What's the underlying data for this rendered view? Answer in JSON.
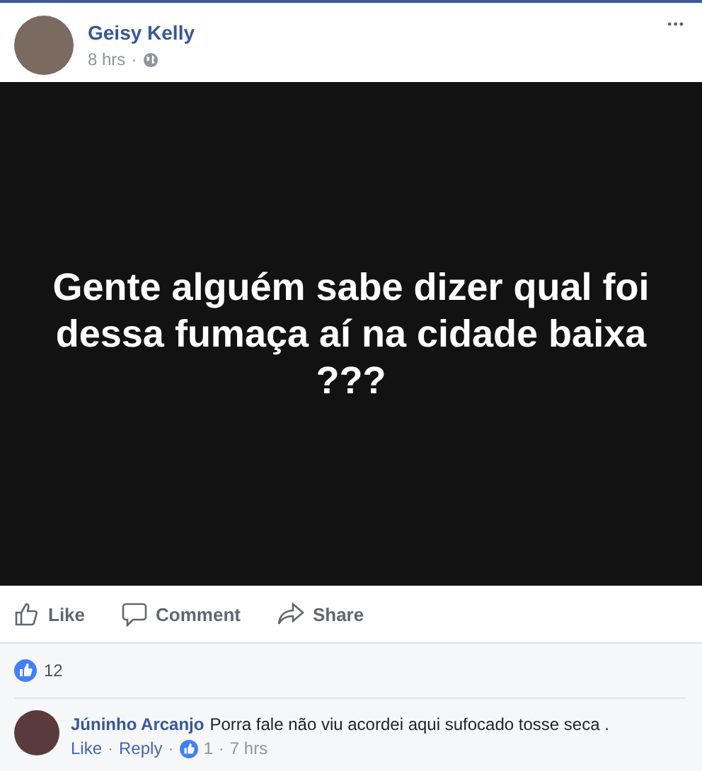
{
  "post": {
    "author": "Geisy Kelly",
    "time": "8 hrs",
    "separator": "·",
    "more": "•••",
    "image_text": "Gente alguém sabe dizer qual foi dessa fumaça aí na cidade baixa ???"
  },
  "actions": [
    {
      "kind": "like",
      "label": "Like"
    },
    {
      "kind": "comment",
      "label": "Comment"
    },
    {
      "kind": "share",
      "label": "Share"
    }
  ],
  "reactions": {
    "count": "12"
  },
  "comment": {
    "author": "Júninho Arcanjo",
    "text": "Porra fale não viu acordei aqui sufocado tosse seca .",
    "meta": [
      {
        "kind": "link",
        "text": "Like"
      },
      {
        "kind": "sep",
        "text": "·"
      },
      {
        "kind": "link",
        "text": "Reply"
      },
      {
        "kind": "sep",
        "text": "·"
      },
      {
        "kind": "likes",
        "text": "1"
      },
      {
        "kind": "sep",
        "text": "·"
      },
      {
        "kind": "time",
        "text": "7 hrs"
      }
    ]
  }
}
